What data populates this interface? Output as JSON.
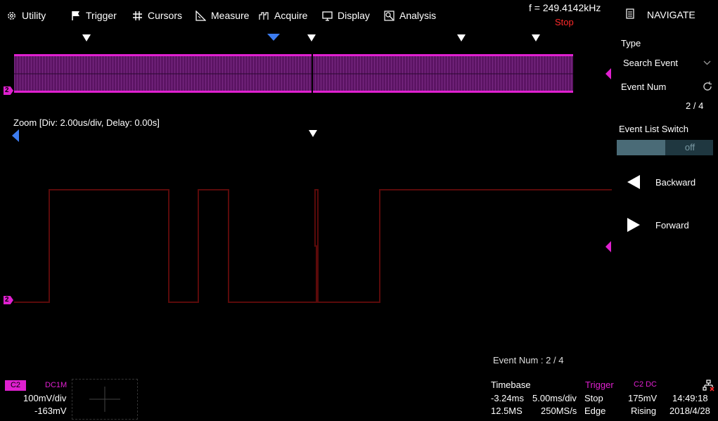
{
  "menu": {
    "utility": "Utility",
    "trigger": "Trigger",
    "cursors": "Cursors",
    "measure": "Measure",
    "acquire": "Acquire",
    "display": "Display",
    "analysis": "Analysis"
  },
  "status": {
    "frequency": "f = 249.4142kHz",
    "run_state": "Stop"
  },
  "overview": {
    "channel_marker": "2"
  },
  "zoom": {
    "label": "Zoom [Div: 2.00us/div,  Delay: 0.00s]",
    "channel_marker": "2"
  },
  "event_overlay": "Event Num : 2 / 4",
  "panel": {
    "title": "NAVIGATE",
    "type_label": "Type",
    "type_value": "Search Event",
    "event_num_label": "Event Num",
    "event_num_value": "2 / 4",
    "event_list_switch_label": "Event List Switch",
    "switch_state": "off",
    "backward": "Backward",
    "forward": "Forward"
  },
  "channel_info": {
    "badge": "C2",
    "coupling": "DC1M",
    "scale": "100mV/div",
    "offset": "-163mV"
  },
  "timebase": {
    "label": "Timebase",
    "delay": "-3.24ms",
    "scale": "5.00ms/div",
    "memory": "12.5MS",
    "sample_rate": "250MS/s"
  },
  "trigger": {
    "label": "Trigger",
    "state": "Stop",
    "type": "Edge",
    "source": "C2 DC",
    "level": "175mV",
    "slope": "Rising"
  },
  "clock": {
    "time": "14:49:18",
    "date": "2018/4/28"
  },
  "colors": {
    "channel2": "#e020d0",
    "stop": "#ff2a2a",
    "trigger_pos": "#3c7cf0",
    "zoom_trace": "#5a0a0a"
  }
}
